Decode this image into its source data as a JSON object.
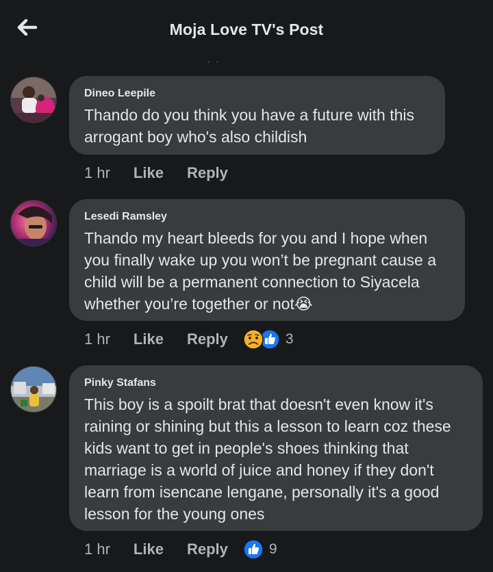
{
  "header": {
    "title": "Moja Love TV's Post",
    "back_icon": "back-arrow-icon"
  },
  "comments": [
    {
      "author": "Dineo Leepile",
      "text": "Thando do you think you have a future with this arrogant boy who's also childish",
      "time": "1 hr",
      "like_label": "Like",
      "reply_label": "Reply",
      "reactions": [],
      "reaction_count": ""
    },
    {
      "author": "Lesedi Ramsley",
      "text": "Thando my heart bleeds for you and I hope when you finally wake up you won’t be pregnant cause a child will be a permanent connection to Siyacela whether you’re together or not😭",
      "time": "1 hr",
      "like_label": "Like",
      "reply_label": "Reply",
      "reactions": [
        "sad-reaction-icon",
        "like-reaction-icon"
      ],
      "reaction_count": "3"
    },
    {
      "author": "Pinky Stafans",
      "text": "This boy is a spoilt brat that doesn't even know it's raining or shining but this a lesson to learn coz these kids want to get in people's shoes thinking that marriage is a world of juice and honey if they don't learn from isencane lengane, personally it's a good lesson for the young ones",
      "time": "1 hr",
      "like_label": "Like",
      "reply_label": "Reply",
      "reactions": [
        "like-reaction-icon"
      ],
      "reaction_count": "9"
    }
  ],
  "colors": {
    "background": "#18191a",
    "bubble": "#3a3b3c",
    "text": "#e4e6eb",
    "secondary_text": "#b0b3b8",
    "like_blue": "#1877f2",
    "sad_yellow": "#f7b125"
  }
}
